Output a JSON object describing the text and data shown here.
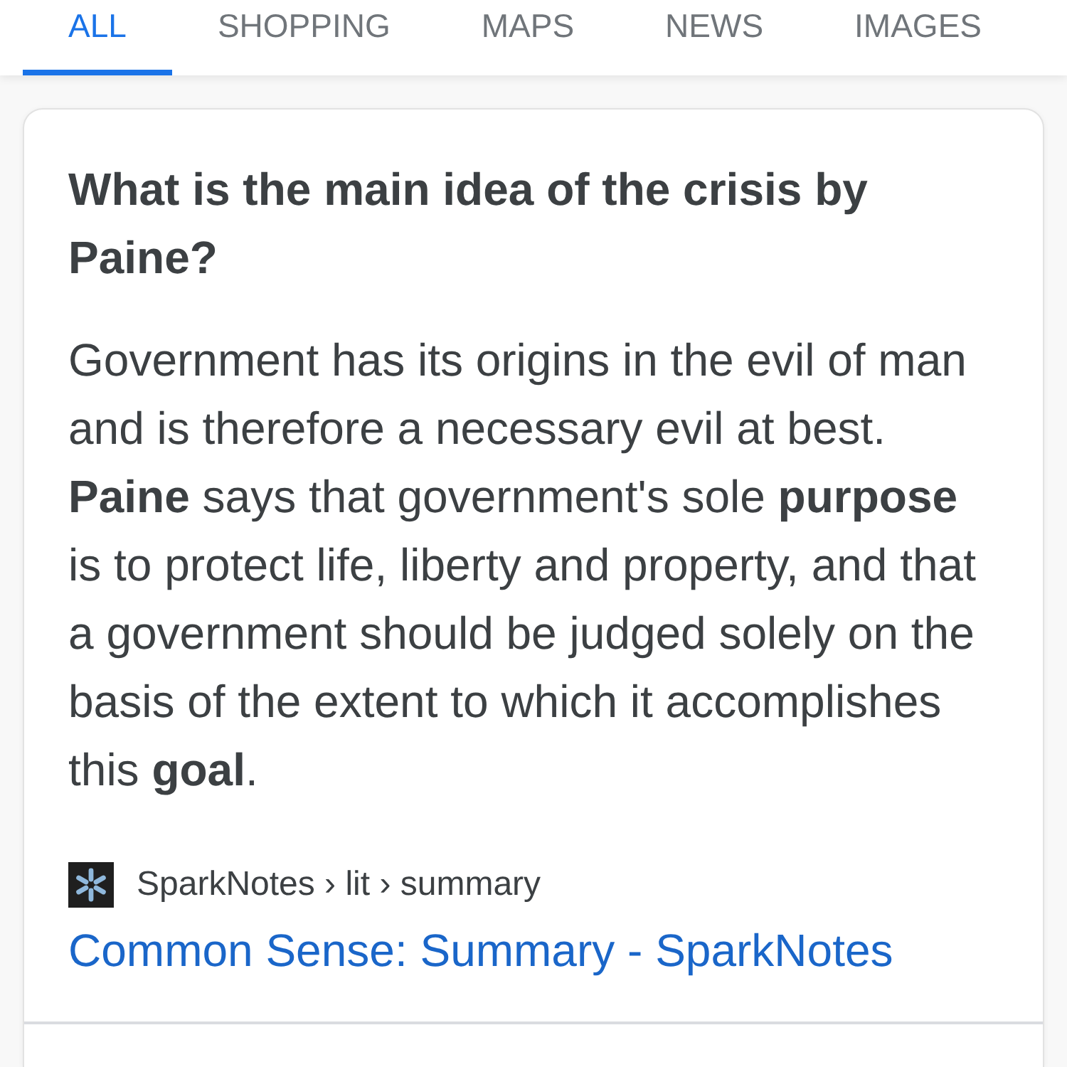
{
  "tabs": [
    {
      "label": "ALL",
      "selected": true
    },
    {
      "label": "SHOPPING",
      "selected": false
    },
    {
      "label": "MAPS",
      "selected": false
    },
    {
      "label": "NEWS",
      "selected": false
    },
    {
      "label": "IMAGES",
      "selected": false
    }
  ],
  "card": {
    "question": "What is the main idea of the crisis by Paine?",
    "answer": "Government has its origins in the evil of man and is therefore a necessary evil at best. **Paine** says that government's sole **purpose** is to protect life, liberty and property, and that a government should be judged solely on the basis of the extent to which it accomplishes this **goal**.",
    "source": {
      "breadcrumb": "SparkNotes › lit › summary",
      "link": "Common Sense: Summary - SparkNotes"
    }
  }
}
